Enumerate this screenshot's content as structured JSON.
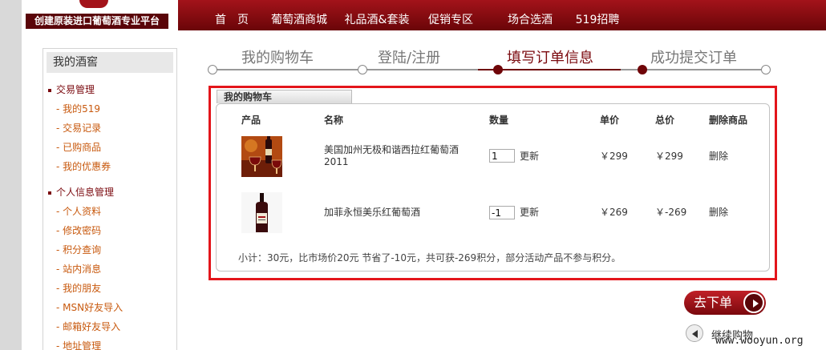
{
  "header": {
    "logo_text": "创建原装进口葡萄酒专业平台",
    "nav": [
      "首　页",
      "葡萄酒商城",
      "礼品酒&套装",
      "促销专区",
      "场合选酒",
      "519招聘"
    ]
  },
  "sidebar": {
    "title": "我的酒窖",
    "groups": [
      {
        "title": "交易管理",
        "links": [
          "- 我的519",
          "- 交易记录",
          "- 已购商品",
          "- 我的优惠券"
        ]
      },
      {
        "title": "个人信息管理",
        "links": [
          "- 个人资料",
          "- 修改密码",
          "- 积分查询",
          "- 站内消息",
          "- 我的朋友",
          "- MSN好友导入",
          "- 邮箱好友导入",
          "- 地址管理"
        ]
      }
    ]
  },
  "steps": [
    "我的购物车",
    "登陆/注册",
    "填写订单信息",
    "成功提交订单"
  ],
  "cart": {
    "tab_title": "我的购物车",
    "headers": [
      "产品",
      "名称",
      "数量",
      "单价",
      "总价",
      "删除商品"
    ],
    "rows": [
      {
        "name": "美国加州无极和谐西拉红葡萄酒2011",
        "qty": "1",
        "update": "更新",
        "unit_price": "￥299",
        "total": "￥299",
        "delete": "删除",
        "image": "wine-glasses-image"
      },
      {
        "name": "加菲永恒美乐红葡萄酒",
        "qty": "-1",
        "update": "更新",
        "unit_price": "￥269",
        "total": "￥-269",
        "delete": "删除",
        "image": "wine-bottle-image"
      }
    ],
    "subtotal": "小计：30元，比市场价20元 节省了-10元，共可获-269积分，部分活动产品不参与积分。"
  },
  "actions": {
    "place_order": "去下单",
    "continue_shopping": "继续购物"
  },
  "watermark": "www.wooyun.org",
  "colors": {
    "brand": "#7b0a0f",
    "highlight": "#e3151b",
    "link": "#c8590e"
  }
}
